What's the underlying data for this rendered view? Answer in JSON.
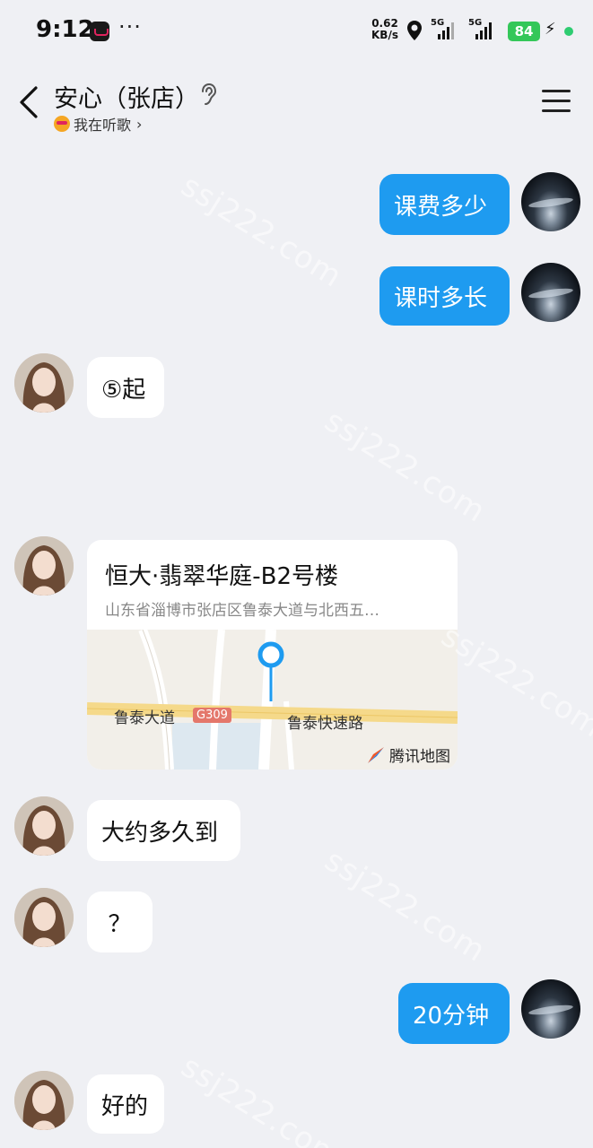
{
  "status_bar": {
    "time": "9:12",
    "dots": "···",
    "net_speed_value": "0.62",
    "net_speed_unit": "KB/s",
    "sim1_label": "5G",
    "sim2_label": "5G",
    "battery": "84",
    "icons": [
      "app-icon",
      "location-icon",
      "signal-icon",
      "charging-icon"
    ]
  },
  "header": {
    "title": "安心（张店）",
    "subtitle": "我在听歌",
    "icons": [
      "back-icon",
      "ear-icon",
      "menu-icon"
    ]
  },
  "messages": [
    {
      "sender": "self",
      "text": "课费多少"
    },
    {
      "sender": "self",
      "text": "课时多长"
    },
    {
      "sender": "other",
      "text": "⑤起"
    },
    {
      "sender": "other",
      "type": "location",
      "location": {
        "title": "恒大·翡翠华庭-B2号楼",
        "address": "山东省淄博市张店区鲁泰大道与北西五…",
        "road_label_1": "鲁泰大道",
        "road_badge": "G309",
        "road_label_2": "鲁泰快速路",
        "map_brand": "腾讯地图"
      }
    },
    {
      "sender": "other",
      "text": "大约多久到"
    },
    {
      "sender": "other",
      "text": "？"
    },
    {
      "sender": "self",
      "text": "20分钟"
    },
    {
      "sender": "other",
      "text": "好的"
    }
  ],
  "watermark": "ssj222.com",
  "colors": {
    "background": "#eff0f4",
    "self_bubble": "#1e9bf0",
    "other_bubble": "#ffffff",
    "battery": "#34c759"
  }
}
